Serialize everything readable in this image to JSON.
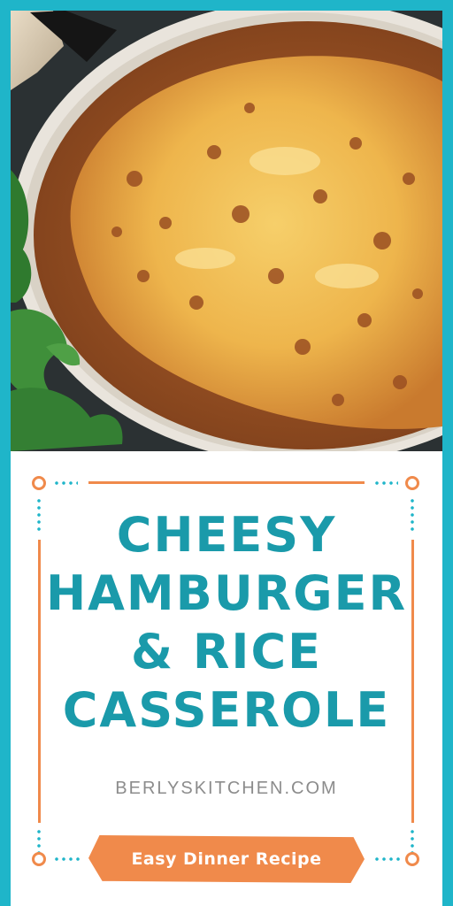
{
  "pin": {
    "title_lines": [
      "CHEESY",
      "HAMBURGER",
      "& RICE",
      "CASSEROLE"
    ],
    "website": "BERLYSKITCHEN.COM",
    "badge": "Easy Dinner Recipe"
  },
  "colors": {
    "border": "#1fb5c9",
    "title": "#1a9aaa",
    "accent": "#f08a4b",
    "website": "#8c8c8c"
  }
}
